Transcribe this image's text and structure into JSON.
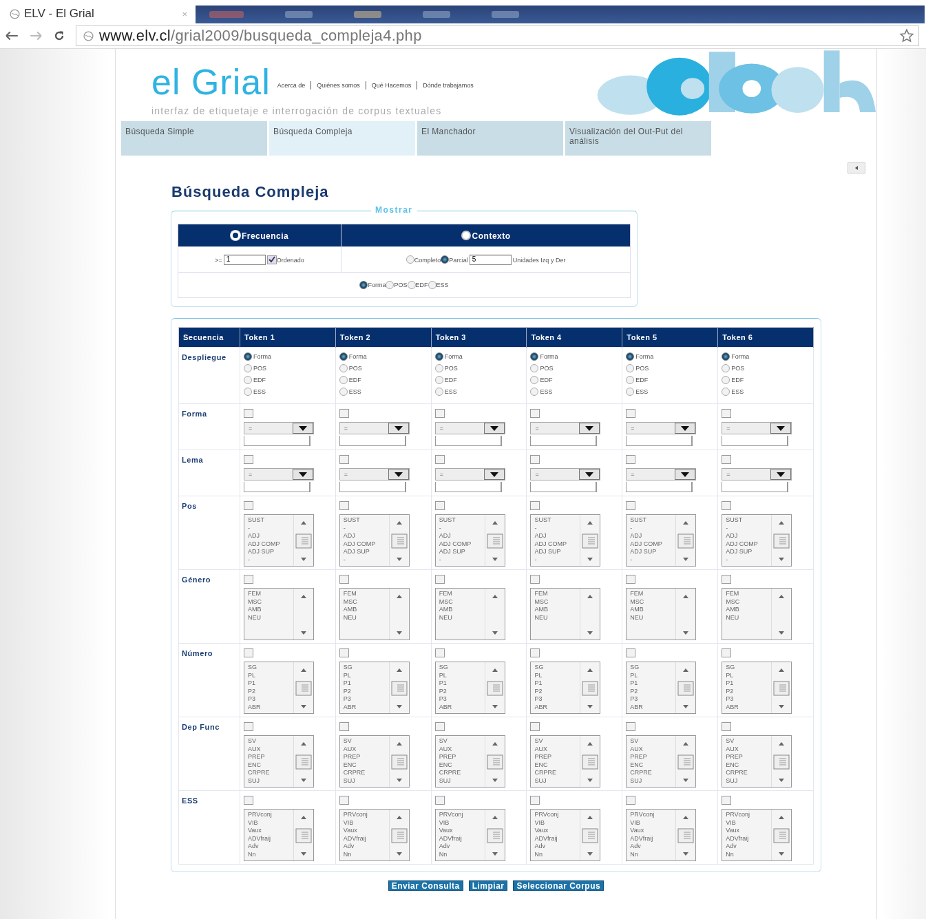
{
  "browser": {
    "tab_title": "ELV - El Grial",
    "tab_close": "×",
    "url_host": "www.elv.cl",
    "url_path": "/grial2009/busqueda_compleja4.php"
  },
  "header": {
    "logo": "el Grial",
    "links": [
      "Acerca de",
      "Quiénes somos",
      "Qué Hacemos",
      "Dónde trabajamos"
    ],
    "tagline": "interfaz de etiquetaje e interrogación de corpus textuales"
  },
  "nav": [
    {
      "label": "Búsqueda Simple",
      "selected": false
    },
    {
      "label": "Búsqueda Compleja",
      "selected": true
    },
    {
      "label": "El Manchador",
      "selected": false
    },
    {
      "label": "Visualización del Out-Put del análisis",
      "selected": false
    }
  ],
  "title": "Búsqueda Compleja",
  "mostrar": {
    "legend": "Mostrar",
    "modes": [
      {
        "label": "Frecuencia",
        "selected": true
      },
      {
        "label": "Contexto",
        "selected": false
      }
    ],
    "frequency": {
      "operator": ">=",
      "value": "1",
      "ordered_label": "Ordenado",
      "ordered": true
    },
    "context": {
      "options": [
        {
          "label": "Completo",
          "selected": false
        },
        {
          "label": "Parcial",
          "selected": true
        }
      ],
      "value": "5",
      "units_label": "Unidades Izq y Der"
    },
    "display": [
      {
        "label": "Forma",
        "selected": true
      },
      {
        "label": "POS",
        "selected": false
      },
      {
        "label": "EDF",
        "selected": false
      },
      {
        "label": "ESS",
        "selected": false
      }
    ]
  },
  "grid": {
    "corner": "Secuencia",
    "columns": [
      "Token 1",
      "Token 2",
      "Token 3",
      "Token 4",
      "Token 5",
      "Token 6"
    ],
    "rows": [
      {
        "label": "Despliegue",
        "kind": "radios",
        "cells": [
          {
            "options": [
              {
                "label": "Forma",
                "selected": true
              },
              {
                "label": "POS",
                "selected": false
              },
              {
                "label": "EDF",
                "selected": false
              },
              {
                "label": "ESS",
                "selected": false
              }
            ]
          },
          {
            "options": [
              {
                "label": "Forma",
                "selected": true
              },
              {
                "label": "POS",
                "selected": false
              },
              {
                "label": "EDF",
                "selected": false
              },
              {
                "label": "ESS",
                "selected": false
              }
            ]
          },
          {
            "options": [
              {
                "label": "Forma",
                "selected": true
              },
              {
                "label": "POS",
                "selected": false
              },
              {
                "label": "EDF",
                "selected": false
              },
              {
                "label": "ESS",
                "selected": false
              }
            ]
          },
          {
            "options": [
              {
                "label": "Forma",
                "selected": true
              },
              {
                "label": "POS",
                "selected": false
              },
              {
                "label": "EDF",
                "selected": false
              },
              {
                "label": "ESS",
                "selected": false
              }
            ]
          },
          {
            "options": [
              {
                "label": "Forma",
                "selected": true
              },
              {
                "label": "POS",
                "selected": false
              },
              {
                "label": "EDF",
                "selected": false
              },
              {
                "label": "ESS",
                "selected": false
              }
            ]
          },
          {
            "options": [
              {
                "label": "Forma",
                "selected": true
              },
              {
                "label": "POS",
                "selected": false
              },
              {
                "label": "EDF",
                "selected": false
              },
              {
                "label": "ESS",
                "selected": false
              }
            ]
          }
        ]
      },
      {
        "label": "Forma",
        "kind": "combo",
        "cells": [
          {
            "checked": false,
            "operator": "="
          },
          {
            "checked": false,
            "operator": "="
          },
          {
            "checked": false,
            "operator": "="
          },
          {
            "checked": false,
            "operator": "="
          },
          {
            "checked": false,
            "operator": "="
          },
          {
            "checked": false,
            "operator": "="
          }
        ]
      },
      {
        "label": "Lema",
        "kind": "combo",
        "cells": [
          {
            "checked": false,
            "operator": "="
          },
          {
            "checked": false,
            "operator": "="
          },
          {
            "checked": false,
            "operator": "="
          },
          {
            "checked": false,
            "operator": "="
          },
          {
            "checked": false,
            "operator": "="
          },
          {
            "checked": false,
            "operator": "="
          }
        ]
      },
      {
        "label": "Pos",
        "kind": "list",
        "cells": [
          {
            "checked": false,
            "items": [
              "SUST",
              "-",
              "ADJ",
              "ADJ COMP",
              "ADJ SUP",
              "-"
            ]
          },
          {
            "checked": false,
            "items": [
              "SUST",
              "-",
              "ADJ",
              "ADJ COMP",
              "ADJ SUP",
              "-"
            ]
          },
          {
            "checked": false,
            "items": [
              "SUST",
              "-",
              "ADJ",
              "ADJ COMP",
              "ADJ SUP",
              "-"
            ]
          },
          {
            "checked": false,
            "items": [
              "SUST",
              "-",
              "ADJ",
              "ADJ COMP",
              "ADJ SUP",
              "-"
            ]
          },
          {
            "checked": false,
            "items": [
              "SUST",
              "-",
              "ADJ",
              "ADJ COMP",
              "ADJ SUP",
              "-"
            ]
          },
          {
            "checked": false,
            "items": [
              "SUST",
              "-",
              "ADJ",
              "ADJ COMP",
              "ADJ SUP",
              "-"
            ]
          }
        ]
      },
      {
        "label": "Género",
        "kind": "list",
        "cells": [
          {
            "checked": false,
            "items": [
              "FEM",
              "MSC",
              "AMB",
              "NEU"
            ]
          },
          {
            "checked": false,
            "items": [
              "FEM",
              "MSC",
              "AMB",
              "NEU"
            ]
          },
          {
            "checked": false,
            "items": [
              "FEM",
              "MSC",
              "AMB",
              "NEU"
            ]
          },
          {
            "checked": false,
            "items": [
              "FEM",
              "MSC",
              "AMB",
              "NEU"
            ]
          },
          {
            "checked": false,
            "items": [
              "FEM",
              "MSC",
              "AMB",
              "NEU"
            ]
          },
          {
            "checked": false,
            "items": [
              "FEM",
              "MSC",
              "AMB",
              "NEU"
            ]
          }
        ]
      },
      {
        "label": "Número",
        "kind": "list",
        "cells": [
          {
            "checked": false,
            "items": [
              "SG",
              "PL",
              "P1",
              "P2",
              "P3",
              "ABR"
            ]
          },
          {
            "checked": false,
            "items": [
              "SG",
              "PL",
              "P1",
              "P2",
              "P3",
              "ABR"
            ]
          },
          {
            "checked": false,
            "items": [
              "SG",
              "PL",
              "P1",
              "P2",
              "P3",
              "ABR"
            ]
          },
          {
            "checked": false,
            "items": [
              "SG",
              "PL",
              "P1",
              "P2",
              "P3",
              "ABR"
            ]
          },
          {
            "checked": false,
            "items": [
              "SG",
              "PL",
              "P1",
              "P2",
              "P3",
              "ABR"
            ]
          },
          {
            "checked": false,
            "items": [
              "SG",
              "PL",
              "P1",
              "P2",
              "P3",
              "ABR"
            ]
          }
        ]
      },
      {
        "label": "Dep Func",
        "kind": "list",
        "cells": [
          {
            "checked": false,
            "items": [
              "SV",
              "AUX",
              "PREP",
              "ENC",
              "CRPRE",
              "SUJ"
            ]
          },
          {
            "checked": false,
            "items": [
              "SV",
              "AUX",
              "PREP",
              "ENC",
              "CRPRE",
              "SUJ"
            ]
          },
          {
            "checked": false,
            "items": [
              "SV",
              "AUX",
              "PREP",
              "ENC",
              "CRPRE",
              "SUJ"
            ]
          },
          {
            "checked": false,
            "items": [
              "SV",
              "AUX",
              "PREP",
              "ENC",
              "CRPRE",
              "SUJ"
            ]
          },
          {
            "checked": false,
            "items": [
              "SV",
              "AUX",
              "PREP",
              "ENC",
              "CRPRE",
              "SUJ"
            ]
          },
          {
            "checked": false,
            "items": [
              "SV",
              "AUX",
              "PREP",
              "ENC",
              "CRPRE",
              "SUJ"
            ]
          }
        ]
      },
      {
        "label": "ESS",
        "kind": "list",
        "cells": [
          {
            "checked": false,
            "items": [
              "PRVconj",
              "VIB",
              "Vaux",
              "ADVfraij",
              "Adv",
              "Nn"
            ]
          },
          {
            "checked": false,
            "items": [
              "PRVconj",
              "VIB",
              "Vaux",
              "ADVfraij",
              "Adv",
              "Nn"
            ]
          },
          {
            "checked": false,
            "items": [
              "PRVconj",
              "VIB",
              "Vaux",
              "ADVfraij",
              "Adv",
              "Nn"
            ]
          },
          {
            "checked": false,
            "items": [
              "PRVconj",
              "VIB",
              "Vaux",
              "ADVfraij",
              "Adv",
              "Nn"
            ]
          },
          {
            "checked": false,
            "items": [
              "PRVconj",
              "VIB",
              "Vaux",
              "ADVfraij",
              "Adv",
              "Nn"
            ]
          },
          {
            "checked": false,
            "items": [
              "PRVconj",
              "VIB",
              "Vaux",
              "ADVfraij",
              "Adv",
              "Nn"
            ]
          }
        ]
      }
    ]
  },
  "buttons": [
    "Enviar Consulta",
    "Limpiar",
    "Seleccionar Corpus"
  ]
}
